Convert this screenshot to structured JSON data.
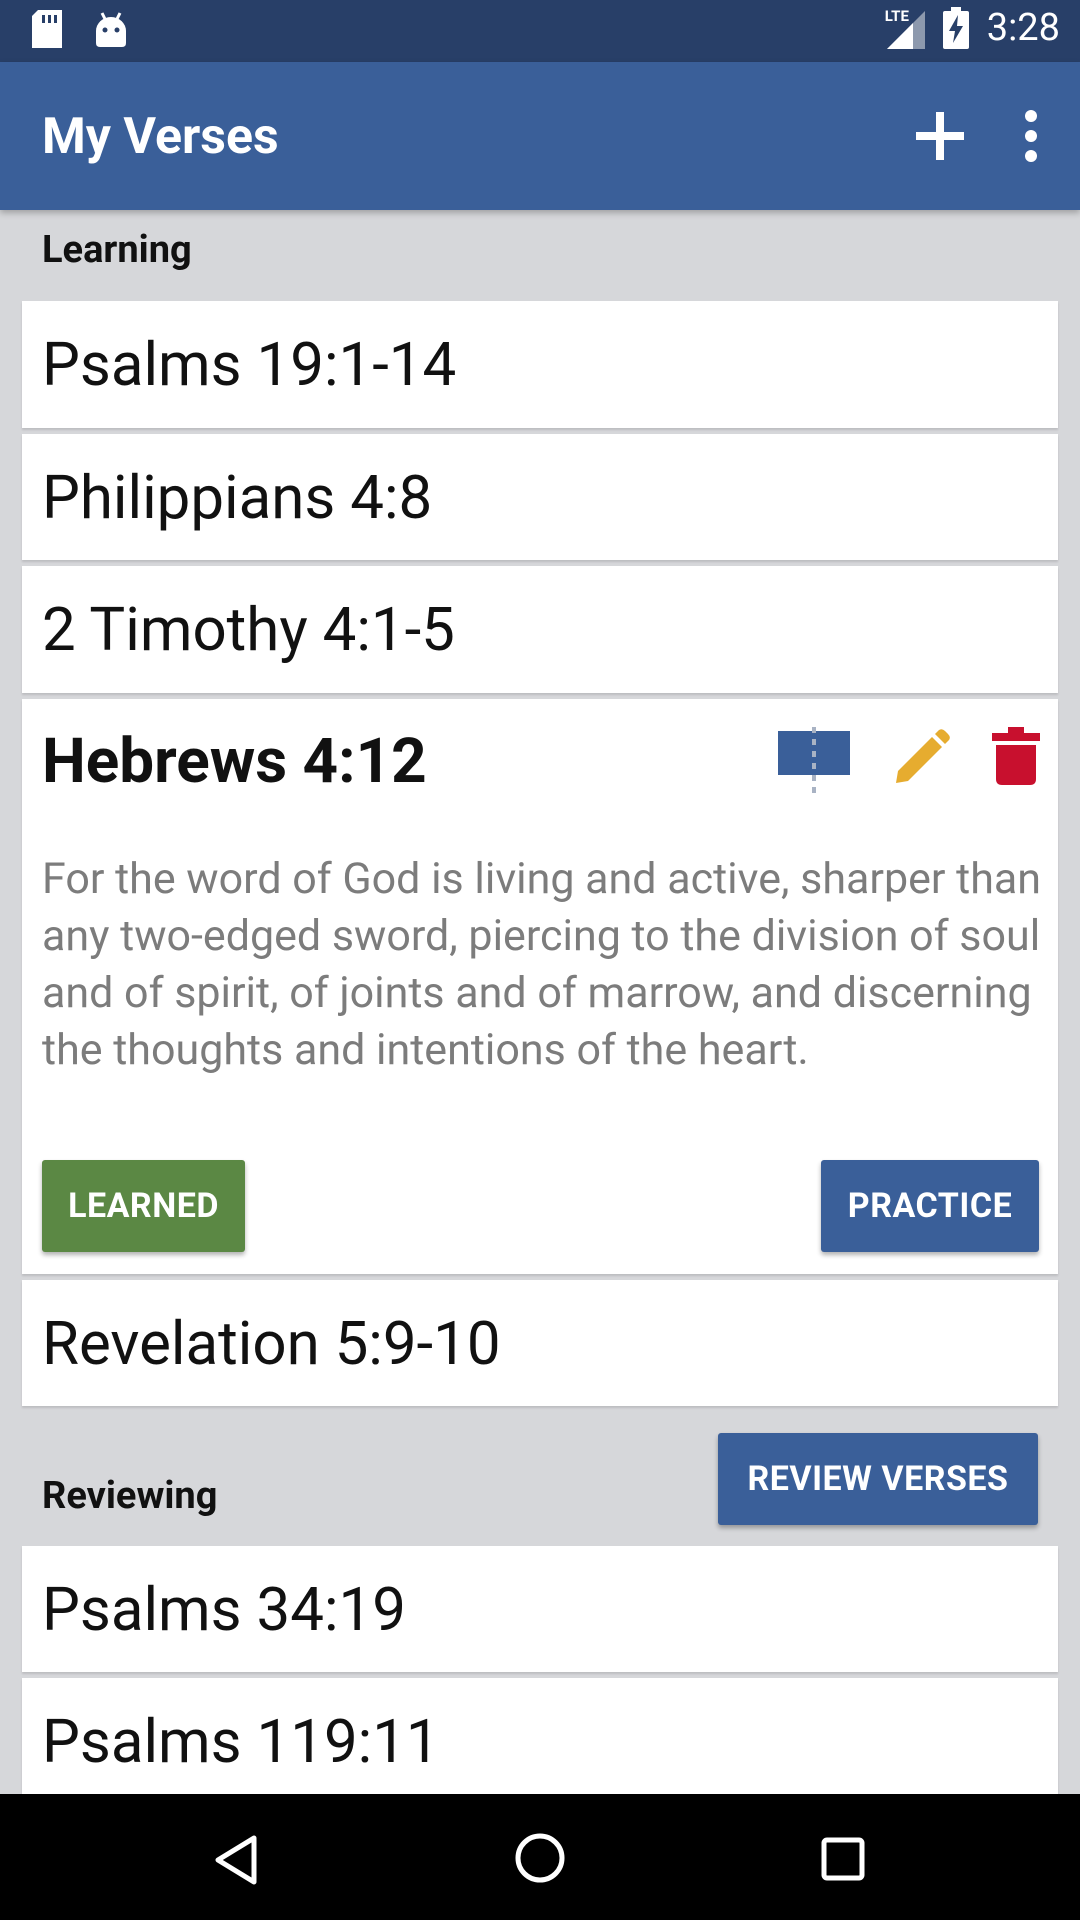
{
  "status_bar": {
    "network": "LTE",
    "time": "3:28"
  },
  "app_bar": {
    "title": "My Verses"
  },
  "learning": {
    "label": "Learning",
    "items": [
      {
        "reference": "Psalms 19:1-14"
      },
      {
        "reference": "Philippians 4:8"
      },
      {
        "reference": "2 Timothy 4:1-5"
      }
    ],
    "expanded": {
      "reference": "Hebrews 4:12",
      "text": "For the word of God is living and active, sharper than any two-edged sword, piercing to the division of soul and of spirit, of joints and of marrow, and discerning the thoughts and intentions of the heart.",
      "learned_label": "LEARNED",
      "practice_label": "PRACTICE"
    },
    "after": {
      "reference": "Revelation 5:9-10"
    }
  },
  "reviewing": {
    "label": "Reviewing",
    "review_button": "REVIEW VERSES",
    "items": [
      {
        "reference": "Psalms 34:19"
      },
      {
        "reference": "Psalms 119:11"
      }
    ]
  },
  "colors": {
    "app_bar": "#3a5f99",
    "status_bar": "#283f68",
    "learned": "#5b8844",
    "edit": "#e6ac2f",
    "delete": "#c8102e"
  },
  "icons": [
    "sd-card-icon",
    "android-icon",
    "signal-icon",
    "battery-charging-icon",
    "add-icon",
    "more-vert-icon",
    "move-icon",
    "edit-icon",
    "delete-icon",
    "back-icon",
    "home-icon",
    "recents-icon"
  ]
}
